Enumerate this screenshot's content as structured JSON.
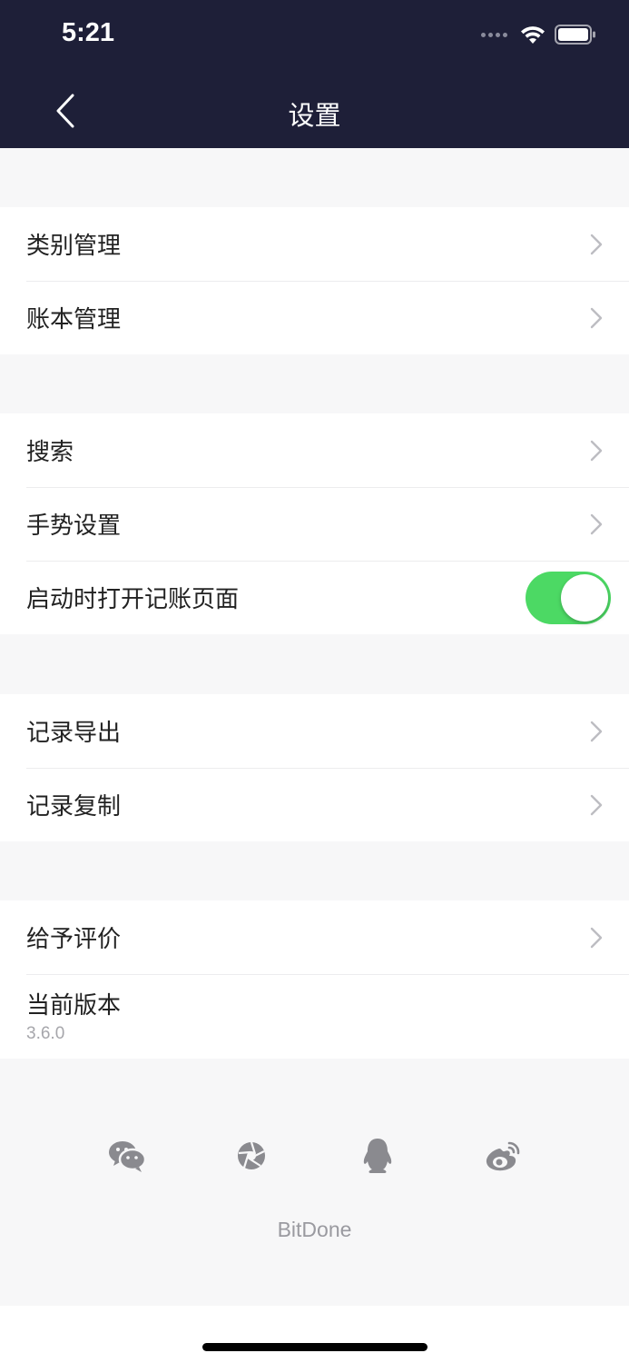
{
  "status_bar": {
    "time": "5:21"
  },
  "nav": {
    "title": "设置"
  },
  "groups": [
    {
      "items": [
        {
          "label": "类别管理"
        },
        {
          "label": "账本管理"
        }
      ]
    },
    {
      "items": [
        {
          "label": "搜索"
        },
        {
          "label": "手势设置"
        },
        {
          "label": "启动时打开记账页面",
          "toggle_on": true
        }
      ]
    },
    {
      "items": [
        {
          "label": "记录导出"
        },
        {
          "label": "记录复制"
        }
      ]
    },
    {
      "items": [
        {
          "label": "给予评价"
        }
      ],
      "version": {
        "label": "当前版本",
        "value": "3.6.0"
      }
    }
  ],
  "social_icons": [
    "wechat-icon",
    "camera-shutter-icon",
    "qq-penguin-icon",
    "weibo-icon"
  ],
  "brand": "BitDone",
  "colors": {
    "nav_background": "#1e1f38",
    "toggle_on": "#4cd964",
    "page_background": "#f7f7f8"
  }
}
